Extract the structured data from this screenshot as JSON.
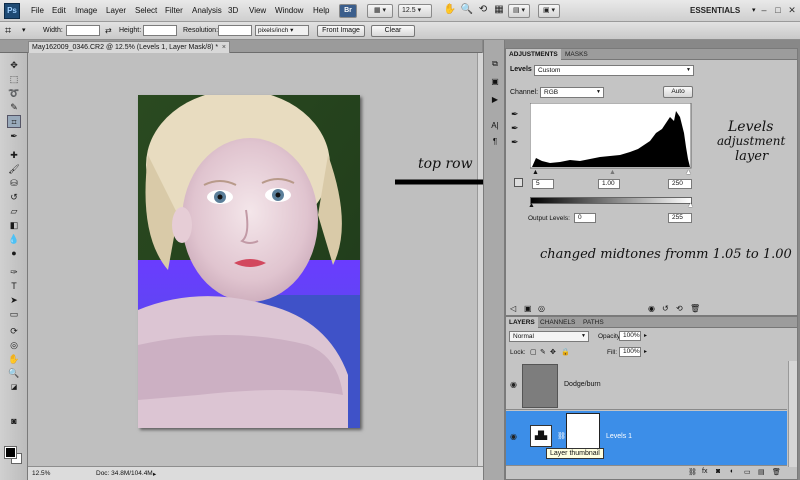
{
  "app": {
    "logo": "Ps"
  },
  "menu": [
    "File",
    "Edit",
    "Image",
    "Layer",
    "Select",
    "Filter",
    "Analysis",
    "3D",
    "View",
    "Window",
    "Help"
  ],
  "menubar": {
    "br_label": "Br",
    "zoom": "12.5",
    "workspace": "ESSENTIALS"
  },
  "options": {
    "width_label": "Width:",
    "height_label": "Height:",
    "resolution_label": "Resolution:",
    "units": "pixels/inch",
    "front_image": "Front Image",
    "clear": "Clear"
  },
  "document": {
    "tab_title": "May162009_0346.CR2 @ 12.5% (Levels 1, Layer Mask/8) *",
    "zoom": "12.5%",
    "doc_size": "Doc: 34.8M/104.4M"
  },
  "annotations": {
    "top_row": "top row",
    "levels_line1": "Levels",
    "levels_line2": "adjustment",
    "levels_line3": "layer",
    "changed": "changed midtones fromm 1.05 to 1.00"
  },
  "adjustments": {
    "tabs": [
      "ADJUSTMENTS",
      "MASKS"
    ],
    "title": "Levels",
    "preset": "Custom",
    "channel_label": "Channel:",
    "channel": "RGB",
    "auto": "Auto",
    "input_black": "5",
    "input_mid": "1.00",
    "input_white": "250",
    "output_label": "Output Levels:",
    "output_black": "0",
    "output_white": "255"
  },
  "layers": {
    "tabs": [
      "LAYERS",
      "CHANNELS",
      "PATHS"
    ],
    "blend_mode": "Normal",
    "opacity_label": "Opacity:",
    "opacity": "100%",
    "lock_label": "Lock:",
    "fill_label": "Fill:",
    "fill": "100%",
    "items": [
      {
        "name": "Dodge/burn",
        "selected": false
      },
      {
        "name": "Levels 1",
        "selected": true
      }
    ],
    "tooltip": "Layer thumbnail"
  },
  "colors": {
    "selection_blue": "#3c8ee8",
    "panel_gray": "#c4c4c4"
  }
}
